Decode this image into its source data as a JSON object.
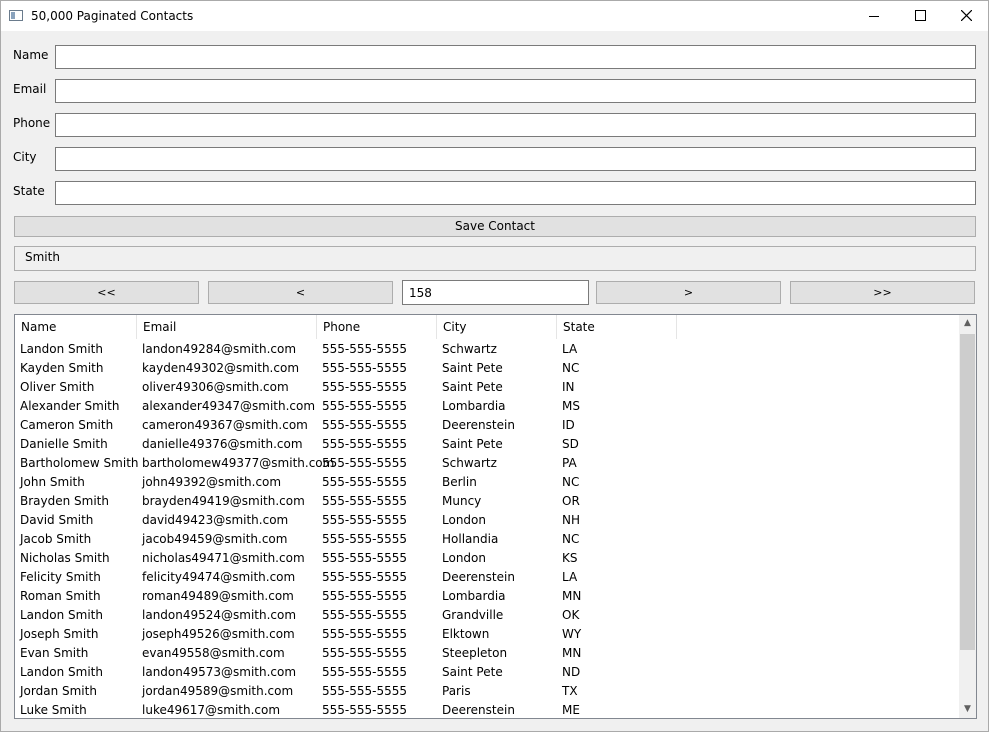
{
  "window": {
    "title": "50,000 Paginated Contacts"
  },
  "form": {
    "name_label": "Name",
    "email_label": "Email",
    "phone_label": "Phone",
    "city_label": "City",
    "state_label": "State",
    "name_value": "",
    "email_value": "",
    "phone_value": "",
    "city_value": "",
    "state_value": "",
    "save_label": "Save Contact"
  },
  "search": {
    "text": "Smith"
  },
  "pager": {
    "first_label": "<<",
    "prev_label": "<",
    "page_value": "158",
    "next_label": ">",
    "last_label": ">>"
  },
  "table": {
    "columns": [
      "Name",
      "Email",
      "Phone",
      "City",
      "State"
    ],
    "rows": [
      [
        "Landon Smith",
        "landon49284@smith.com",
        "555-555-5555",
        "Schwartz",
        "LA"
      ],
      [
        "Kayden Smith",
        "kayden49302@smith.com",
        "555-555-5555",
        "Saint Pete",
        "NC"
      ],
      [
        "Oliver Smith",
        "oliver49306@smith.com",
        "555-555-5555",
        "Saint Pete",
        "IN"
      ],
      [
        "Alexander Smith",
        "alexander49347@smith.com",
        "555-555-5555",
        "Lombardia",
        "MS"
      ],
      [
        "Cameron Smith",
        "cameron49367@smith.com",
        "555-555-5555",
        "Deerenstein",
        "ID"
      ],
      [
        "Danielle Smith",
        "danielle49376@smith.com",
        "555-555-5555",
        "Saint Pete",
        "SD"
      ],
      [
        "Bartholomew Smith",
        "bartholomew49377@smith.com",
        "555-555-5555",
        "Schwartz",
        "PA"
      ],
      [
        "John Smith",
        "john49392@smith.com",
        "555-555-5555",
        "Berlin",
        "NC"
      ],
      [
        "Brayden Smith",
        "brayden49419@smith.com",
        "555-555-5555",
        "Muncy",
        "OR"
      ],
      [
        "David Smith",
        "david49423@smith.com",
        "555-555-5555",
        "London",
        "NH"
      ],
      [
        "Jacob Smith",
        "jacob49459@smith.com",
        "555-555-5555",
        "Hollandia",
        "NC"
      ],
      [
        "Nicholas Smith",
        "nicholas49471@smith.com",
        "555-555-5555",
        "London",
        "KS"
      ],
      [
        "Felicity Smith",
        "felicity49474@smith.com",
        "555-555-5555",
        "Deerenstein",
        "LA"
      ],
      [
        "Roman Smith",
        "roman49489@smith.com",
        "555-555-5555",
        "Lombardia",
        "MN"
      ],
      [
        "Landon Smith",
        "landon49524@smith.com",
        "555-555-5555",
        "Grandville",
        "OK"
      ],
      [
        "Joseph Smith",
        "joseph49526@smith.com",
        "555-555-5555",
        "Elktown",
        "WY"
      ],
      [
        "Evan Smith",
        "evan49558@smith.com",
        "555-555-5555",
        "Steepleton",
        "MN"
      ],
      [
        "Landon Smith",
        "landon49573@smith.com",
        "555-555-5555",
        "Saint Pete",
        "ND"
      ],
      [
        "Jordan Smith",
        "jordan49589@smith.com",
        "555-555-5555",
        "Paris",
        "TX"
      ],
      [
        "Luke Smith",
        "luke49617@smith.com",
        "555-555-5555",
        "Deerenstein",
        "ME"
      ]
    ]
  },
  "icons": {
    "app": "window-app-icon",
    "minimize": "minimize-icon",
    "maximize": "maximize-icon",
    "close": "close-icon",
    "scroll_up": "chevron-up-icon",
    "scroll_down": "chevron-down-icon"
  }
}
